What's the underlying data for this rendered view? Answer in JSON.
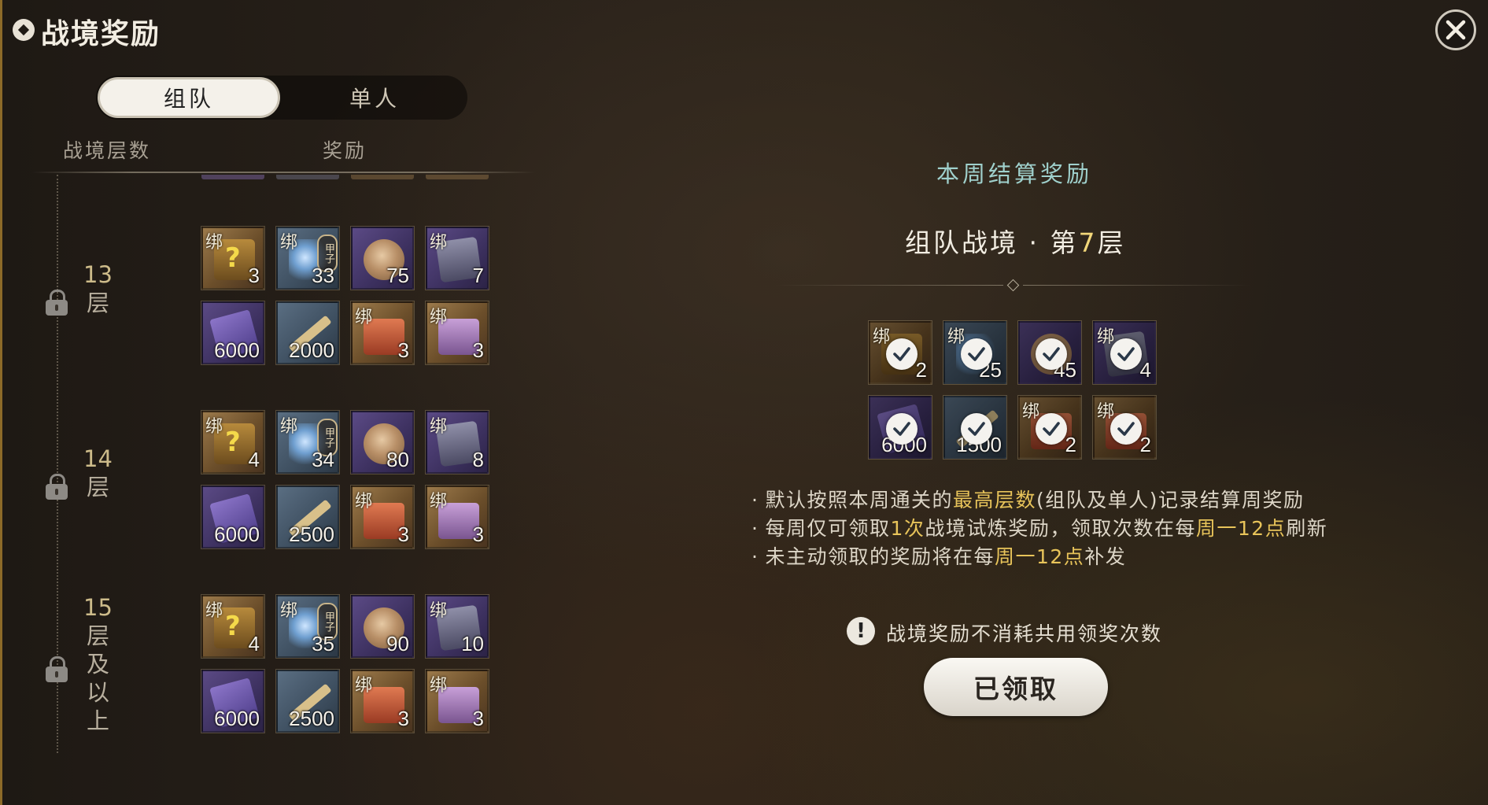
{
  "header": {
    "title": "战境奖励",
    "title_icon": "emblem-icon",
    "close_icon": "close-icon"
  },
  "tabs": [
    {
      "label": "组队",
      "active": true
    },
    {
      "label": "单人",
      "active": false
    }
  ],
  "columns": {
    "tier": "战境层数",
    "reward": "奖励"
  },
  "tiers": [
    {
      "number": "13",
      "label": "层",
      "locked": true,
      "items": [
        {
          "icon": "mystery-chest-icon",
          "bind": "绑",
          "count": "3"
        },
        {
          "icon": "crystal-token-icon",
          "bind": "绑",
          "count": "33",
          "token": "甲子"
        },
        {
          "icon": "bronze-shield-icon",
          "bind": "",
          "count": "75"
        },
        {
          "icon": "equipment-box-icon",
          "bind": "绑",
          "count": "7"
        },
        {
          "icon": "purple-scroll-icon",
          "bind": "",
          "count": "6000"
        },
        {
          "icon": "blade-scroll-icon",
          "bind": "",
          "count": "2000"
        },
        {
          "icon": "red-chest-icon",
          "bind": "绑",
          "count": "3"
        },
        {
          "icon": "purple-chest-icon",
          "bind": "绑",
          "count": "3"
        }
      ]
    },
    {
      "number": "14",
      "label": "层",
      "locked": true,
      "items": [
        {
          "icon": "mystery-chest-icon",
          "bind": "绑",
          "count": "4"
        },
        {
          "icon": "crystal-token-icon",
          "bind": "绑",
          "count": "34",
          "token": "甲子"
        },
        {
          "icon": "bronze-shield-icon",
          "bind": "",
          "count": "80"
        },
        {
          "icon": "equipment-box-icon",
          "bind": "绑",
          "count": "8"
        },
        {
          "icon": "purple-scroll-icon",
          "bind": "",
          "count": "6000"
        },
        {
          "icon": "blade-scroll-icon",
          "bind": "",
          "count": "2500"
        },
        {
          "icon": "red-chest-icon",
          "bind": "绑",
          "count": "3"
        },
        {
          "icon": "purple-chest-icon",
          "bind": "绑",
          "count": "3"
        }
      ]
    },
    {
      "number": "15",
      "label": "层及以上",
      "locked": true,
      "items": [
        {
          "icon": "mystery-chest-icon",
          "bind": "绑",
          "count": "4"
        },
        {
          "icon": "crystal-token-icon",
          "bind": "绑",
          "count": "35",
          "token": "甲子"
        },
        {
          "icon": "bronze-shield-icon",
          "bind": "",
          "count": "90"
        },
        {
          "icon": "equipment-box-icon",
          "bind": "绑",
          "count": "10"
        },
        {
          "icon": "purple-scroll-icon",
          "bind": "",
          "count": "6000"
        },
        {
          "icon": "blade-scroll-icon",
          "bind": "",
          "count": "2500"
        },
        {
          "icon": "red-chest-icon",
          "bind": "绑",
          "count": "3"
        },
        {
          "icon": "purple-chest-icon",
          "bind": "绑",
          "count": "3"
        }
      ]
    }
  ],
  "weekly": {
    "title": "本周结算奖励",
    "tier_prefix": "组队战境 · 第",
    "tier_number": "7",
    "tier_suffix": "层",
    "items": [
      {
        "icon": "mystery-chest-icon",
        "bind": "绑",
        "count": "2",
        "claimed": true
      },
      {
        "icon": "crystal-token-icon",
        "bind": "绑",
        "count": "25",
        "claimed": true
      },
      {
        "icon": "bronze-shield-icon",
        "bind": "",
        "count": "45",
        "claimed": true
      },
      {
        "icon": "equipment-box-icon",
        "bind": "绑",
        "count": "4",
        "claimed": true
      },
      {
        "icon": "purple-scroll-icon",
        "bind": "",
        "count": "6000",
        "claimed": true
      },
      {
        "icon": "blade-scroll-icon",
        "bind": "",
        "count": "1500",
        "claimed": true
      },
      {
        "icon": "red-chest-icon",
        "bind": "绑",
        "count": "2",
        "claimed": true
      },
      {
        "icon": "gold-chest-icon",
        "bind": "绑",
        "count": "2",
        "claimed": true
      }
    ]
  },
  "notes": [
    {
      "parts": [
        {
          "t": "默认按照本周通关的"
        },
        {
          "t": "最高层数",
          "hl": true
        },
        {
          "t": "(组队及单人)记录结算周奖励"
        }
      ]
    },
    {
      "parts": [
        {
          "t": "每周仅可领取"
        },
        {
          "t": "1次",
          "hl": true
        },
        {
          "t": "战境试炼奖励，领取次数在每"
        },
        {
          "t": "周一12点",
          "hl": true
        },
        {
          "t": "刷新"
        }
      ]
    },
    {
      "parts": [
        {
          "t": "未主动领取的奖励将在每"
        },
        {
          "t": "周一12点",
          "hl": true
        },
        {
          "t": "补发"
        }
      ]
    }
  ],
  "warning": {
    "icon": "exclamation-icon",
    "text": "战境奖励不消耗共用领奖次数"
  },
  "claim_button": {
    "label": "已领取"
  },
  "colors": {
    "accent_gold": "#e8c45a",
    "teal_title": "#9fd0cc",
    "tier_gold": "#cdbb8a"
  }
}
